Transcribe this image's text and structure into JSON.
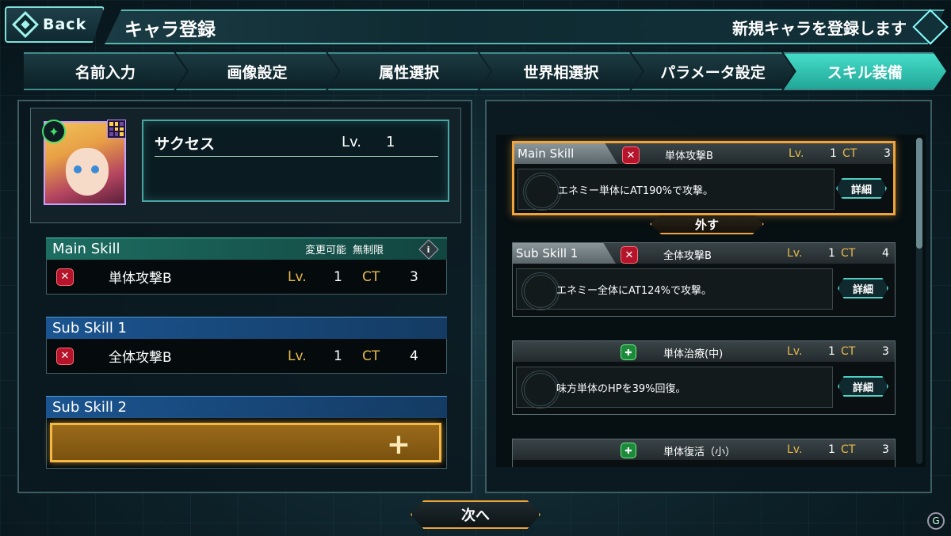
{
  "header": {
    "back_label": "Back",
    "title": "キャラ登録",
    "subtitle": "新規キャラを登録します"
  },
  "tabs": [
    {
      "label": "名前入力",
      "active": false
    },
    {
      "label": "画像設定",
      "active": false
    },
    {
      "label": "属性選択",
      "active": false
    },
    {
      "label": "世界相選択",
      "active": false
    },
    {
      "label": "パラメータ設定",
      "active": false
    },
    {
      "label": "スキル装備",
      "active": true
    }
  ],
  "character": {
    "name": "サクセス",
    "lv_label": "Lv.",
    "lv": "1"
  },
  "equipped": {
    "main": {
      "header": "Main Skill",
      "note1": "変更可能",
      "note2": "無制限",
      "skill": "単体攻撃B",
      "lv_label": "Lv.",
      "lv": "1",
      "ct_label": "CT",
      "ct": "3"
    },
    "sub1": {
      "header": "Sub Skill 1",
      "skill": "全体攻撃B",
      "lv_label": "Lv.",
      "lv": "1",
      "ct_label": "CT",
      "ct": "4"
    },
    "sub2": {
      "header": "Sub Skill 2"
    }
  },
  "skill_list": [
    {
      "tag": "Main Skill",
      "name": "単体攻撃B",
      "lv_label": "Lv.",
      "lv": "1",
      "ct_label": "CT",
      "ct": "3",
      "desc": "エネミー単体にAT190%で攻撃。",
      "detail": "詳細",
      "type": "attack",
      "selected": true
    },
    {
      "tag": "Sub Skill 1",
      "name": "全体攻撃B",
      "lv_label": "Lv.",
      "lv": "1",
      "ct_label": "CT",
      "ct": "4",
      "desc": "エネミー全体にAT124%で攻撃。",
      "detail": "詳細",
      "type": "attack",
      "selected": false
    },
    {
      "tag": "",
      "name": "単体治療(中)",
      "lv_label": "Lv.",
      "lv": "1",
      "ct_label": "CT",
      "ct": "3",
      "desc": "味方単体のHPを39%回復。",
      "detail": "詳細",
      "type": "heal",
      "selected": false
    },
    {
      "tag": "",
      "name": "単体復活（小）",
      "lv_label": "Lv.",
      "lv": "1",
      "ct_label": "CT",
      "ct": "3",
      "desc": "",
      "detail": "",
      "type": "revive",
      "selected": false
    }
  ],
  "remove_label": "外す",
  "next_label": "次へ",
  "colors": {
    "accent": "#45dcc9",
    "gold": "#f0a43a",
    "main_skill": "#1d6d62",
    "sub_skill": "#1b5490",
    "attack": "#b5142a",
    "heal": "#1c8a3a"
  },
  "icons": {
    "back": "diamond-icon",
    "attack": "crossed-swords-icon",
    "heal": "heal-icon",
    "info": "info-icon",
    "add": "plus-icon",
    "element": "element-icon",
    "grid": "grid-icon"
  }
}
